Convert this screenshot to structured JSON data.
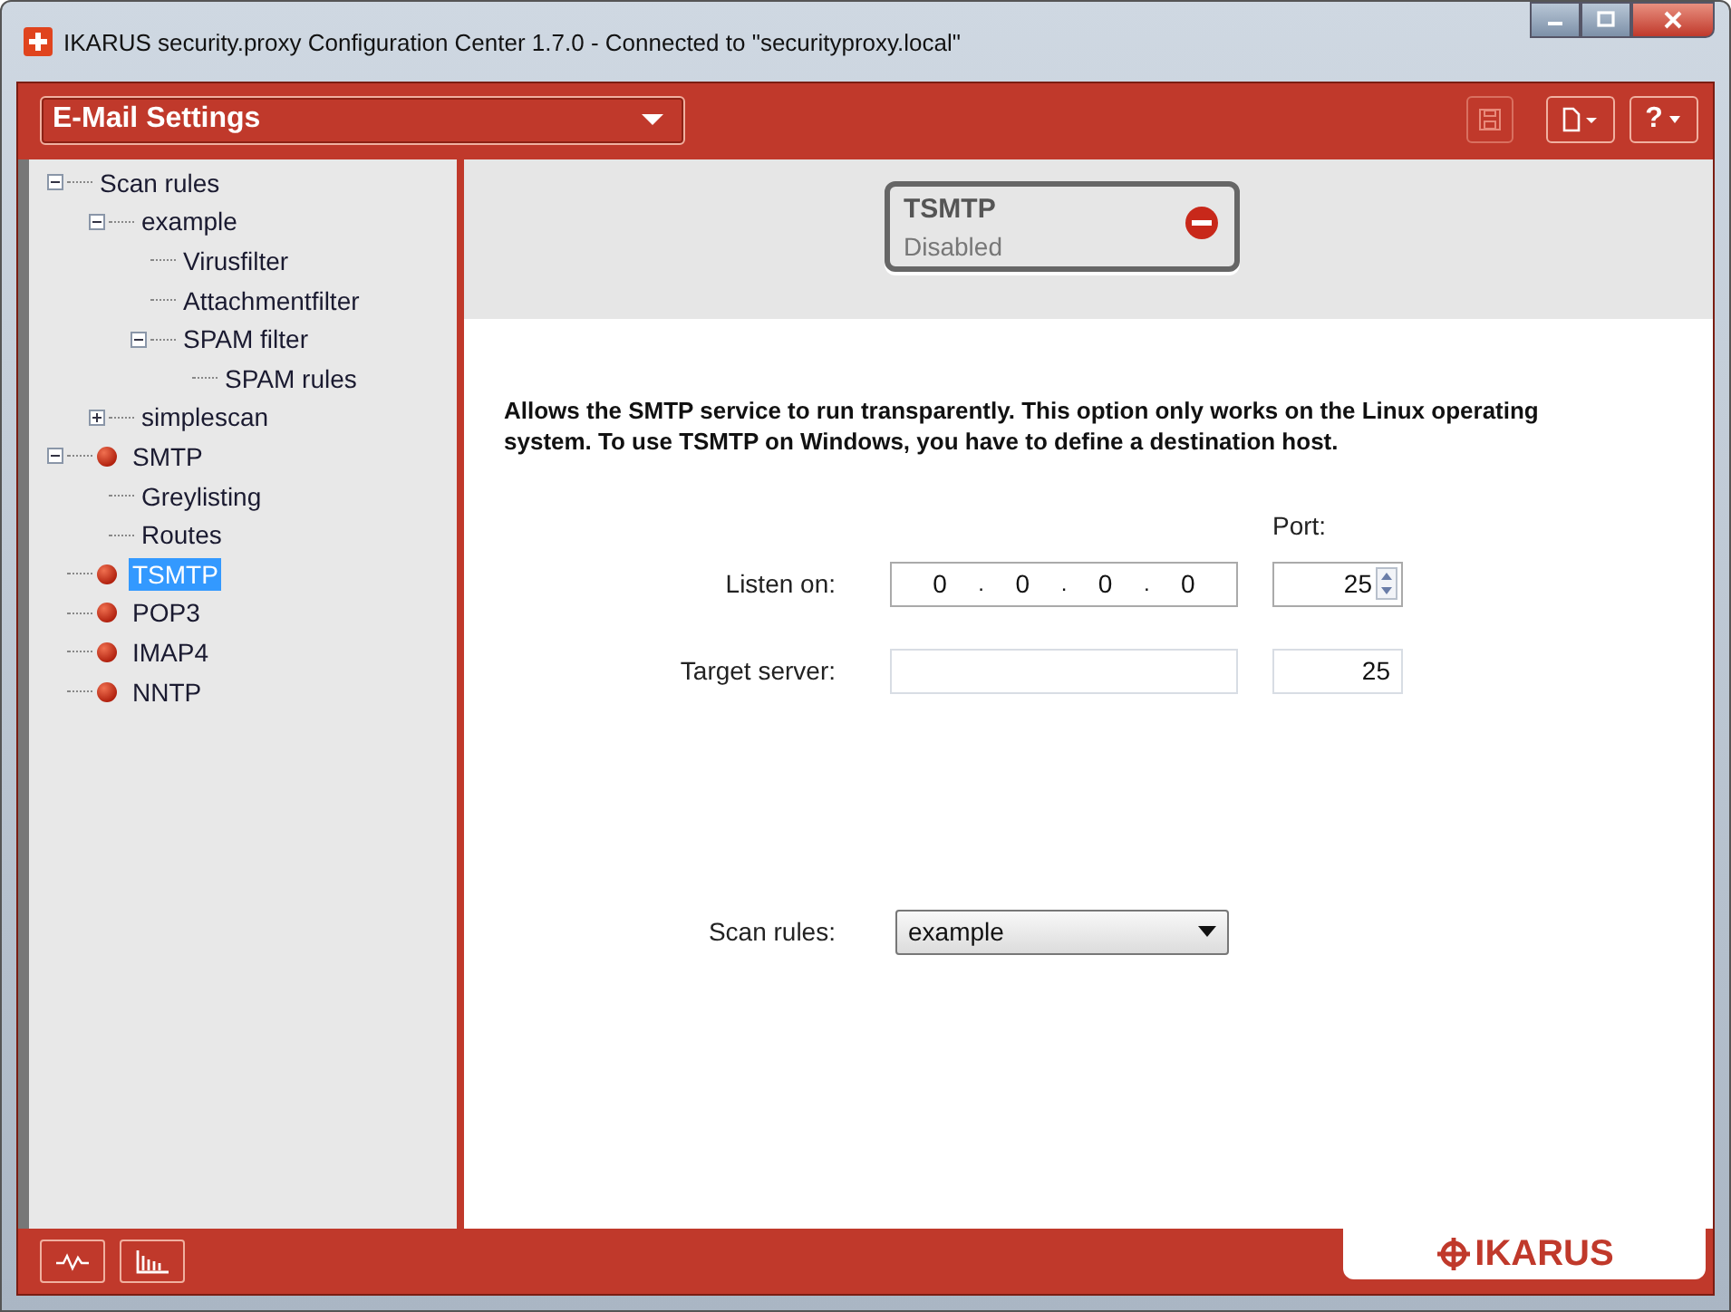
{
  "window": {
    "title": "IKARUS security.proxy Configuration Center  1.7.0 - Connected to \"securityproxy.local\""
  },
  "toolbar": {
    "section": "E-Mail Settings",
    "buttons": [
      {
        "kind": "save",
        "disabled": true
      },
      {
        "kind": "new"
      },
      {
        "kind": "help",
        "label": "?"
      }
    ]
  },
  "tree": [
    {
      "label": "Scan rules",
      "expanded": true,
      "children": [
        {
          "label": "example",
          "expanded": true,
          "children": [
            {
              "label": "Virusfilter"
            },
            {
              "label": "Attachmentfilter"
            },
            {
              "label": "SPAM filter",
              "expanded": true,
              "children": [
                {
                  "label": "SPAM rules"
                }
              ]
            }
          ]
        },
        {
          "label": "simplescan",
          "expanded": false
        }
      ]
    },
    {
      "label": "SMTP",
      "dot": true,
      "expanded": true,
      "children": [
        {
          "label": "Greylisting"
        },
        {
          "label": "Routes"
        }
      ]
    },
    {
      "label": "TSMTP",
      "dot": true,
      "selected": true
    },
    {
      "label": "POP3",
      "dot": true
    },
    {
      "label": "IMAP4",
      "dot": true
    },
    {
      "label": "NNTP",
      "dot": true
    }
  ],
  "status_card": {
    "title": "TSMTP",
    "status": "Disabled",
    "enabled": false
  },
  "description": "Allows the SMTP service to run transparently. This option only works on the Linux operating system. To use TSMTP on Windows, you have to define a destination host.",
  "form": {
    "port_label": "Port:",
    "listen_label": "Listen on:",
    "listen_ip": [
      "0",
      "0",
      "0",
      "0"
    ],
    "ip_separator": ".",
    "listen_port": "25",
    "target_label": "Target server:",
    "target_port": "25",
    "scan_label": "Scan rules:",
    "scan_value": "example"
  },
  "brand": "IKARUS"
}
